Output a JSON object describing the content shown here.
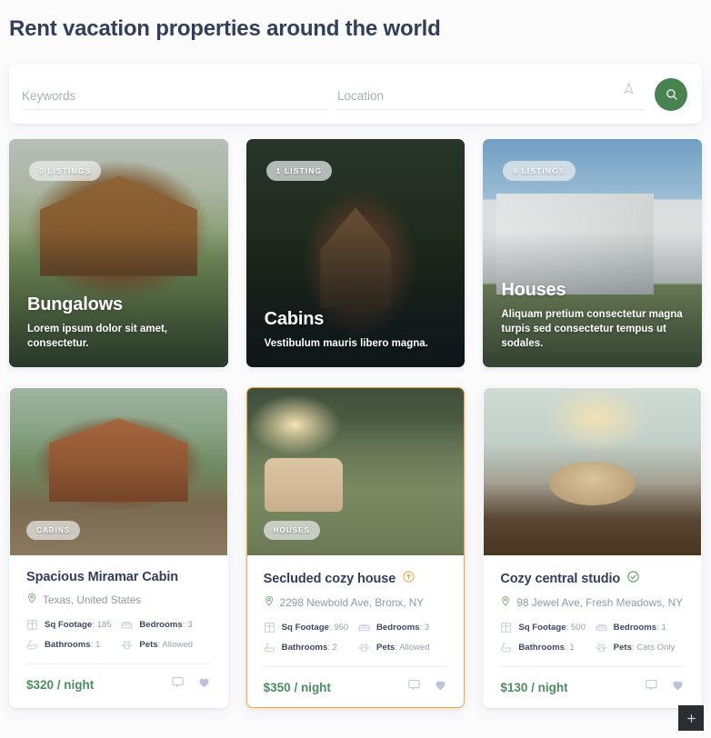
{
  "page": {
    "title": "Rent vacation properties around the world"
  },
  "search": {
    "keywords_placeholder": "Keywords",
    "keywords_value": "",
    "location_placeholder": "Location",
    "location_value": "",
    "locate_icon": "navigation-arrow-icon",
    "search_icon": "search-icon",
    "accent_color": "#46834f"
  },
  "categories": [
    {
      "badge": "0 LISTINGS",
      "title": "Bungalows",
      "description": "Lorem ipsum dolor sit amet, consectetur.",
      "photo": "bungalow-wooden-house-photo"
    },
    {
      "badge": "1 LISTING",
      "title": "Cabins",
      "description": "Vestibulum mauris libero magna.",
      "photo": "a-frame-cabin-forest-photo"
    },
    {
      "badge": "6 LISTINGS",
      "title": "Houses",
      "description": "Aliquam pretium consectetur magna turpis sed consectetur tempus ut sodales.",
      "photo": "white-modern-house-photo"
    }
  ],
  "properties": [
    {
      "category_pill": "CABINS",
      "title": "Spacious Miramar Cabin",
      "badge_icon": "",
      "location": "Texas, United States",
      "stats": [
        {
          "label": "Sq Footage",
          "value": "185",
          "icon": "floorplan-icon"
        },
        {
          "label": "Bedrooms",
          "value": "3",
          "icon": "bed-icon"
        },
        {
          "label": "Bathrooms",
          "value": "1",
          "icon": "bathtub-icon"
        },
        {
          "label": "Pets",
          "value": "Allowed",
          "icon": "paw-icon"
        }
      ],
      "price": "$320 / night",
      "featured": false,
      "photo": "log-cabin-exterior-photo"
    },
    {
      "category_pill": "HOUSES",
      "title": "Secluded cozy house",
      "badge_icon": "featured-arrow-icon",
      "location": "2298 Newbold Ave, Bronx, NY",
      "stats": [
        {
          "label": "Sq Footage",
          "value": "950",
          "icon": "floorplan-icon"
        },
        {
          "label": "Bedrooms",
          "value": "3",
          "icon": "bed-icon"
        },
        {
          "label": "Bathrooms",
          "value": "2",
          "icon": "bathtub-icon"
        },
        {
          "label": "Pets",
          "value": "Allowed",
          "icon": "paw-icon"
        }
      ],
      "price": "$350 / night",
      "featured": true,
      "photo": "green-interior-plants-photo"
    },
    {
      "category_pill": "",
      "title": "Cozy central studio",
      "badge_icon": "verified-check-icon",
      "location": "98 Jewel Ave, Fresh Meadows, NY",
      "stats": [
        {
          "label": "Sq Footage",
          "value": "500",
          "icon": "floorplan-icon"
        },
        {
          "label": "Bedrooms",
          "value": "1",
          "icon": "bed-icon"
        },
        {
          "label": "Bathrooms",
          "value": "1",
          "icon": "bathtub-icon"
        },
        {
          "label": "Pets",
          "value": "Cats Only",
          "icon": "paw-icon"
        }
      ],
      "price": "$130 / night",
      "featured": false,
      "photo": "dining-nook-studio-photo"
    }
  ],
  "fab": {
    "icon": "plus-icon",
    "label": "+"
  },
  "colors": {
    "price_green": "#4d8d5f",
    "featured_orange": "#e9a84c",
    "title_navy": "#333f59"
  }
}
